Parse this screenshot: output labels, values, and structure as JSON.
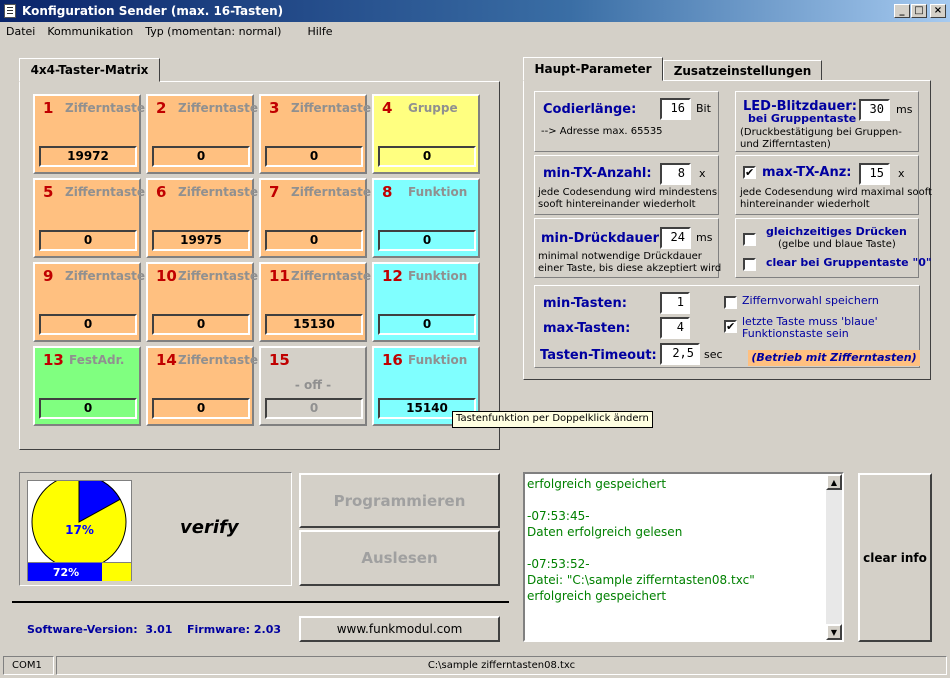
{
  "window": {
    "title": "Konfiguration Sender (max. 16-Tasten)"
  },
  "menu": [
    "Datei",
    "Kommunikation",
    "Typ (momentan: normal)",
    "Hilfe"
  ],
  "matrix": {
    "tab_label": "4x4-Taster-Matrix",
    "keys": [
      {
        "num": "1",
        "label": "Zifferntaste",
        "value": "19972",
        "color": "orange"
      },
      {
        "num": "2",
        "label": "Zifferntaste",
        "value": "0",
        "color": "orange"
      },
      {
        "num": "3",
        "label": "Zifferntaste",
        "value": "0",
        "color": "orange"
      },
      {
        "num": "4",
        "label": "Gruppe",
        "value": "0",
        "color": "yellow"
      },
      {
        "num": "5",
        "label": "Zifferntaste",
        "value": "0",
        "color": "orange"
      },
      {
        "num": "6",
        "label": "Zifferntaste",
        "value": "19975",
        "color": "orange"
      },
      {
        "num": "7",
        "label": "Zifferntaste",
        "value": "0",
        "color": "orange"
      },
      {
        "num": "8",
        "label": "Funktion",
        "value": "0",
        "color": "cyan"
      },
      {
        "num": "9",
        "label": "Zifferntaste",
        "value": "0",
        "color": "orange"
      },
      {
        "num": "10",
        "label": "Zifferntaste",
        "value": "0",
        "color": "orange"
      },
      {
        "num": "11",
        "label": "Zifferntaste",
        "value": "15130",
        "color": "orange"
      },
      {
        "num": "12",
        "label": "Funktion",
        "value": "0",
        "color": "cyan"
      },
      {
        "num": "13",
        "label": "FestAdr.",
        "value": "0",
        "color": "green"
      },
      {
        "num": "14",
        "label": "Zifferntaste",
        "value": "0",
        "color": "orange"
      },
      {
        "num": "15",
        "label": "- off -",
        "value": "0",
        "color": "grey"
      },
      {
        "num": "16",
        "label": "Funktion",
        "value": "15140",
        "color": "cyan"
      }
    ],
    "tooltip": "Tastenfunktion per Doppelklick ändern"
  },
  "tabs": {
    "main": "Haupt-Parameter",
    "extra": "Zusatzeinstellungen"
  },
  "params": {
    "codierlaenge": {
      "label": "Codierlänge:",
      "value": "16",
      "unit": "Bit",
      "note": "--> Adresse max. 65535"
    },
    "led": {
      "label": "LED-Blitzdauer:",
      "sub": "bei Gruppentaste",
      "value": "30",
      "unit": "ms",
      "note1": "(Druckbestätigung bei Gruppen-",
      "note2": "und Zifferntasten)"
    },
    "min_tx": {
      "label": "min-TX-Anzahl:",
      "value": "8",
      "unit": "x",
      "note1": "jede Codesendung wird mindestens",
      "note2": "sooft hintereinander wiederholt"
    },
    "max_tx": {
      "label": "max-TX-Anz:",
      "value": "15",
      "unit": "x",
      "checked": "✔",
      "note1": "jede Codesendung wird maximal sooft",
      "note2": "hintereinander wiederholt"
    },
    "min_druck": {
      "label": "min-Drückdauer:",
      "value": "24",
      "unit": "ms",
      "note1": "minimal notwendige Drückdauer",
      "note2": "einer Taste, bis diese akzeptiert wird"
    },
    "gleich": {
      "label": "gleichzeitiges Drücken",
      "sub": "(gelbe und blaue Taste)"
    },
    "clear_grp": {
      "label": "clear bei Gruppentaste \"0\""
    },
    "min_tasten": {
      "label": "min-Tasten:",
      "value": "1"
    },
    "max_tasten": {
      "label": "max-Tasten:",
      "value": "4"
    },
    "timeout": {
      "label": "Tasten-Timeout:",
      "value": "2,5",
      "unit": "sec"
    },
    "ziffernvorwahl": {
      "label": "Ziffernvorwahl speichern"
    },
    "letzte": {
      "label1": "letzte Taste muss 'blaue'",
      "label2": "Funktionstaste sein",
      "checked": "✔"
    },
    "betrieb": "(Betrieb mit Zifferntasten)"
  },
  "progress": {
    "pie_percent": "17%",
    "pie_fraction": 0.17,
    "bar_percent": "72%",
    "bar_fraction": 0.72,
    "status": "verify"
  },
  "buttons": {
    "program": "Programmieren",
    "read": "Auslesen",
    "clear": "clear info",
    "website": "www.funkmodul.com"
  },
  "versions": {
    "software": "Software-Version:  3.01",
    "firmware": "Firmware: 2.03"
  },
  "log": [
    "erfolgreich gespeichert",
    "",
    " -07:53:45-",
    "Daten erfolgreich gelesen",
    "",
    " -07:53:52-",
    "Datei:  \"C:\\sample zifferntasten08.txc\"",
    "erfolgreich gespeichert"
  ],
  "statusbar": {
    "port": "COM1",
    "file": "C:\\sample zifferntasten08.txc"
  },
  "colors": {
    "orange": "#ffc080",
    "yellow": "#ffff80",
    "cyan": "#80ffff",
    "green": "#80ff80",
    "grey": "#d4d0c8",
    "title_blue": "#0a246a"
  }
}
